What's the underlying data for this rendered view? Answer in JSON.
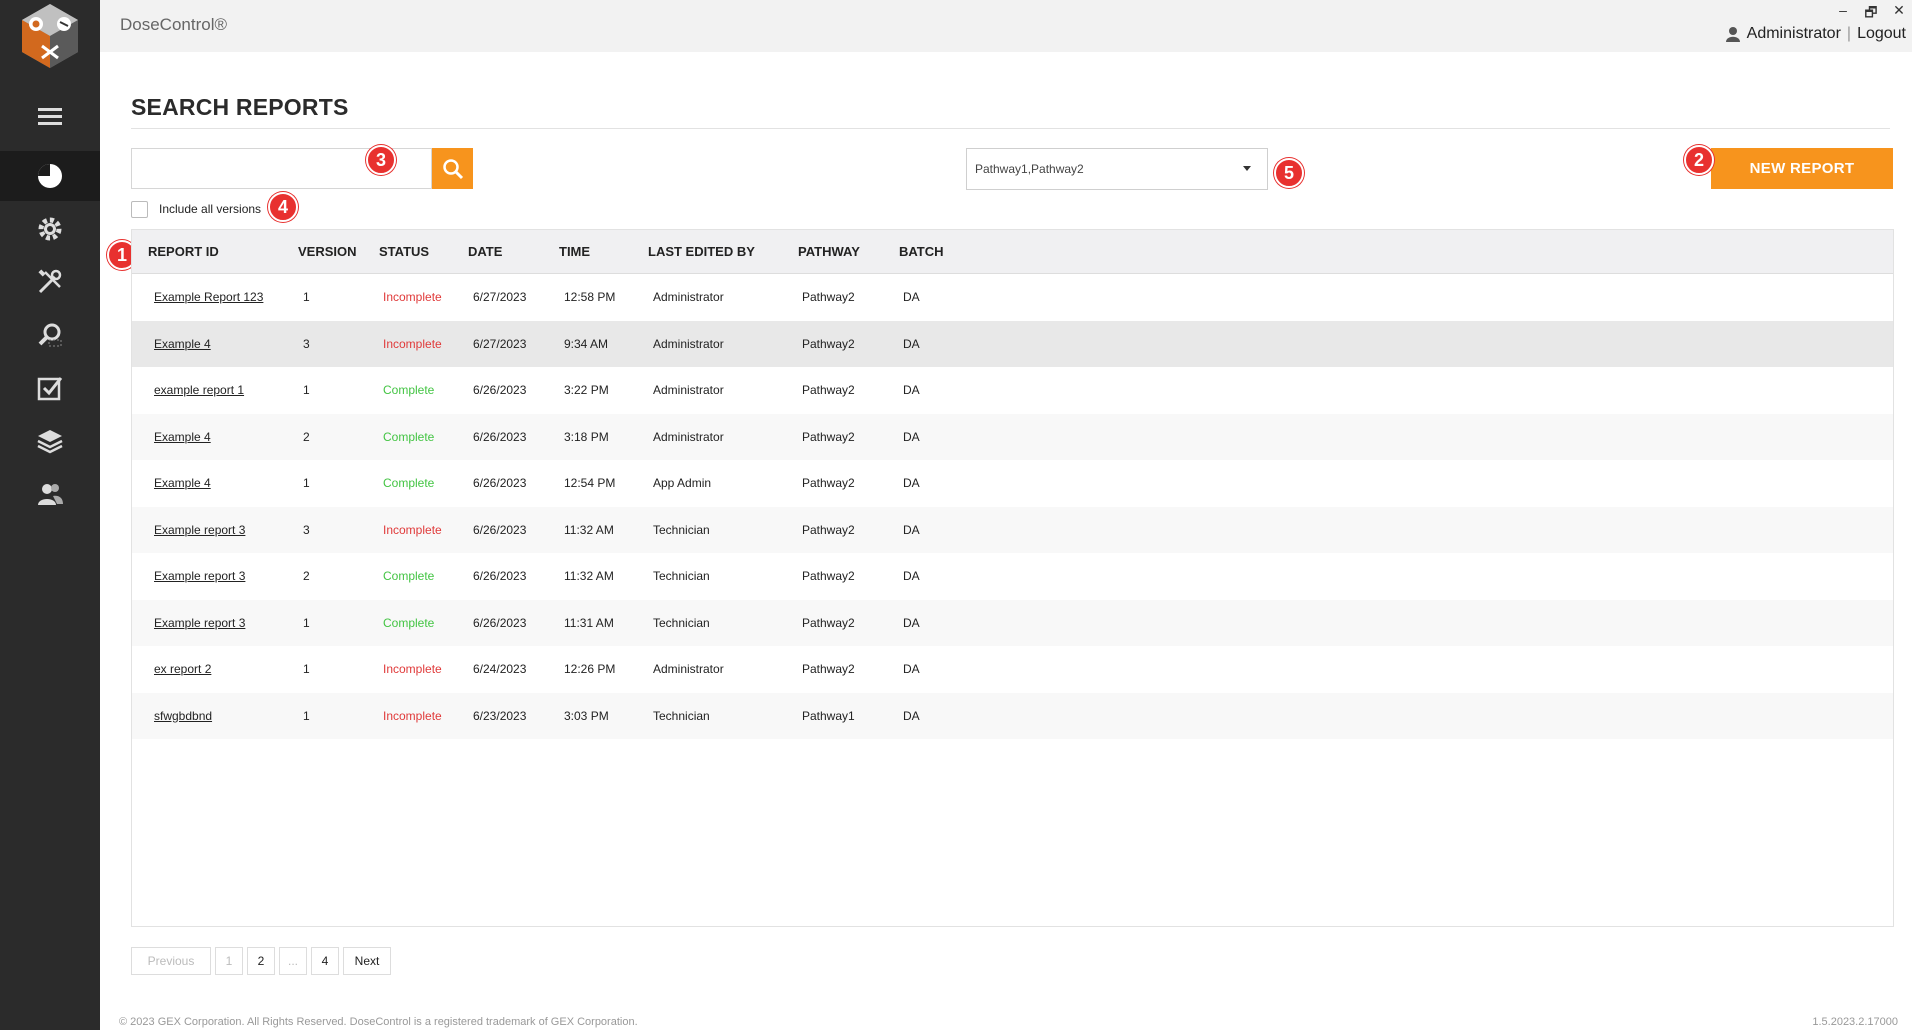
{
  "app": {
    "title": "DoseControl®"
  },
  "window_controls": {
    "minimize": "–",
    "restore": "🗗",
    "close": "✕"
  },
  "user": {
    "name": "Administrator",
    "separator": "|",
    "logout": "Logout",
    "icon": "user-icon"
  },
  "sidebar": {
    "items": [
      {
        "name": "menu",
        "icon": "hamburger-icon"
      },
      {
        "name": "dashboard",
        "icon": "pie-chart-icon",
        "active": true
      },
      {
        "name": "settings",
        "icon": "gear-icon"
      },
      {
        "name": "tools",
        "icon": "tools-icon"
      },
      {
        "name": "search",
        "icon": "magnifier-icon"
      },
      {
        "name": "tasks",
        "icon": "checkbox-icon"
      },
      {
        "name": "layers",
        "icon": "layers-icon"
      },
      {
        "name": "users",
        "icon": "users-icon"
      }
    ]
  },
  "page": {
    "title": "SEARCH REPORTS"
  },
  "search": {
    "value": "",
    "placeholder": "",
    "icon": "search-icon"
  },
  "include_versions": {
    "label": "Include all versions",
    "checked": false
  },
  "pathway_filter": {
    "value": "Pathway1,Pathway2"
  },
  "new_report": {
    "label": "NEW REPORT"
  },
  "callouts": [
    "1",
    "2",
    "3",
    "4",
    "5"
  ],
  "table": {
    "columns": [
      "REPORT ID",
      "VERSION",
      "STATUS",
      "DATE",
      "TIME",
      "LAST EDITED BY",
      "PATHWAY",
      "BATCH"
    ],
    "rows": [
      {
        "id": "Example Report 123",
        "version": "1",
        "status": "Incomplete",
        "date": "6/27/2023",
        "time": "12:58 PM",
        "editor": "Administrator",
        "pathway": "Pathway2",
        "batch": "DA"
      },
      {
        "id": "Example 4",
        "version": "3",
        "status": "Incomplete",
        "date": "6/27/2023",
        "time": "9:34 AM",
        "editor": "Administrator",
        "pathway": "Pathway2",
        "batch": "DA"
      },
      {
        "id": "example report 1",
        "version": "1",
        "status": "Complete",
        "date": "6/26/2023",
        "time": "3:22 PM",
        "editor": "Administrator",
        "pathway": "Pathway2",
        "batch": "DA"
      },
      {
        "id": "Example 4",
        "version": "2",
        "status": "Complete",
        "date": "6/26/2023",
        "time": "3:18 PM",
        "editor": "Administrator",
        "pathway": "Pathway2",
        "batch": "DA"
      },
      {
        "id": "Example 4",
        "version": "1",
        "status": "Complete",
        "date": "6/26/2023",
        "time": "12:54 PM",
        "editor": "App Admin",
        "pathway": "Pathway2",
        "batch": "DA"
      },
      {
        "id": "Example report 3",
        "version": "3",
        "status": "Incomplete",
        "date": "6/26/2023",
        "time": "11:32 AM",
        "editor": "Technician",
        "pathway": "Pathway2",
        "batch": "DA"
      },
      {
        "id": "Example report 3",
        "version": "2",
        "status": "Complete",
        "date": "6/26/2023",
        "time": "11:32 AM",
        "editor": "Technician",
        "pathway": "Pathway2",
        "batch": "DA"
      },
      {
        "id": "Example report 3",
        "version": "1",
        "status": "Complete",
        "date": "6/26/2023",
        "time": "11:31 AM",
        "editor": "Technician",
        "pathway": "Pathway2",
        "batch": "DA"
      },
      {
        "id": "ex report 2",
        "version": "1",
        "status": "Incomplete",
        "date": "6/24/2023",
        "time": "12:26 PM",
        "editor": "Administrator",
        "pathway": "Pathway2",
        "batch": "DA"
      },
      {
        "id": "sfwgbdbnd",
        "version": "1",
        "status": "Incomplete",
        "date": "6/23/2023",
        "time": "3:03 PM",
        "editor": "Technician",
        "pathway": "Pathway1",
        "batch": "DA"
      }
    ],
    "hover_row": 1
  },
  "pagination": {
    "previous": "Previous",
    "pages": [
      "1",
      "2",
      "...",
      "4"
    ],
    "next": "Next",
    "current": "1"
  },
  "footer": {
    "copyright": "© 2023 GEX Corporation. All Rights Reserved. DoseControl is a registered trademark of GEX Corporation.",
    "version": "1.5.2023.2.17000"
  },
  "colors": {
    "accent": "#f7941d",
    "sidebar": "#2b2b2b",
    "incomplete": "#e03a3a",
    "complete": "#43c443",
    "callout": "#e8312f"
  }
}
